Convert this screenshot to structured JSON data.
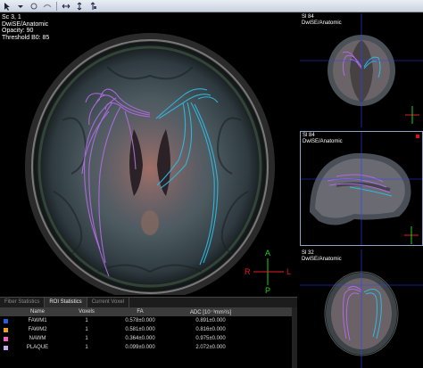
{
  "main_view": {
    "overlay": [
      "Sc 3, 1",
      "DwiSE/Anatomic",
      "Opacity: 90",
      "Threshold B0: 85"
    ],
    "orientation": {
      "anterior": "A",
      "posterior": "P",
      "right": "R",
      "left": "L"
    }
  },
  "side_views": [
    {
      "lines": [
        "Sl 84",
        "DwiSE/Anatomic"
      ]
    },
    {
      "lines": [
        "Sl 84",
        "DwiSE/Anatomic"
      ]
    },
    {
      "lines": [
        "Sl 32",
        "DwiSE/Anatomic"
      ]
    }
  ],
  "tabs": [
    "Fiber Statistics",
    "ROI Statistics",
    "Current Voxel"
  ],
  "active_tab": "ROI Statistics",
  "roi_table": {
    "headers": [
      "Name",
      "Voxels",
      "FA",
      "ADC [10⁻³mm²/s]"
    ],
    "rows": [
      {
        "color": "#2a5ae0",
        "name": "FAWM1",
        "voxels": "1",
        "fa": "0.578±0.000",
        "adc": "0.891±0.000"
      },
      {
        "color": "#f0a020",
        "name": "FAWM2",
        "voxels": "1",
        "fa": "0.581±0.000",
        "adc": "0.816±0.000"
      },
      {
        "color": "#f060c0",
        "name": "NAWM",
        "voxels": "1",
        "fa": "0.364±0.000",
        "adc": "0.975±0.000"
      },
      {
        "color": "#c8a8f0",
        "name": "PLAQUE",
        "voxels": "1",
        "fa": "0.099±0.000",
        "adc": "2.072±0.000"
      }
    ]
  },
  "colors": {
    "left_tract": "#b06ae0",
    "right_tract": "#30b8e0",
    "crosshair": "#3040ff"
  }
}
